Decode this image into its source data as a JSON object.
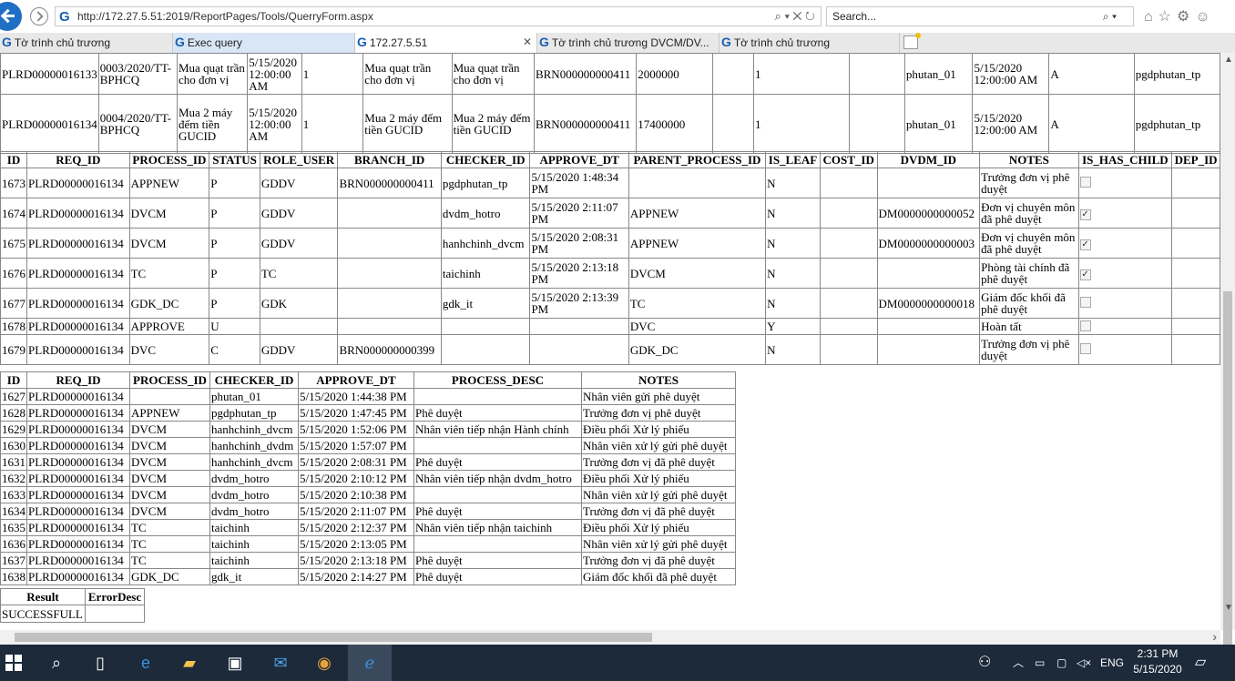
{
  "browser": {
    "url": "http://172.27.5.51:2019/ReportPages/Tools/QuerryForm.aspx",
    "url_icons": "⌕ ▾ ✕ ↻",
    "search_placeholder": "Search...",
    "tabs": [
      {
        "label": "Tờ trình chủ trương"
      },
      {
        "label": "Exec query"
      },
      {
        "label": "172.27.5.51"
      },
      {
        "label": "Tờ trình chủ trương DVCM/DV..."
      },
      {
        "label": "Tờ trình chủ trương"
      }
    ]
  },
  "table1": {
    "rows": [
      [
        "PLRD00000016133",
        "0003/2020/TT-BPHCQ",
        "Mua quạt trần cho đơn vị",
        "5/15/2020 12:00:00 AM",
        "1",
        "Mua quạt trần cho đơn vị",
        "Mua quạt trần cho đơn vị",
        "BRN000000000411",
        "2000000",
        "",
        "1",
        "",
        "phutan_01",
        "5/15/2020 12:00:00 AM",
        "A",
        "pgdphutan_tp"
      ],
      [
        "PLRD00000016134",
        "0004/2020/TT-BPHCQ",
        "Mua 2 máy đếm tiền GUCID",
        "5/15/2020 12:00:00 AM",
        "1",
        "Mua 2 máy đếm tiền GUCID",
        "Mua 2 máy đếm tiền GUCID",
        "BRN000000000411",
        "17400000",
        "",
        "1",
        "",
        "phutan_01",
        "5/15/2020 12:00:00 AM",
        "A",
        "pgdphutan_tp"
      ]
    ]
  },
  "table2": {
    "headers": [
      "ID",
      "REQ_ID",
      "PROCESS_ID",
      "STATUS",
      "ROLE_USER",
      "BRANCH_ID",
      "CHECKER_ID",
      "APPROVE_DT",
      "PARENT_PROCESS_ID",
      "IS_LEAF",
      "COST_ID",
      "DVDM_ID",
      "NOTES",
      "IS_HAS_CHILD",
      "DEP_ID"
    ],
    "rows": [
      [
        "1673",
        "PLRD00000016134",
        "APPNEW",
        "P",
        "GDDV",
        "BRN000000000411",
        "pgdphutan_tp",
        "5/15/2020 1:48:34 PM",
        "",
        "N",
        "",
        "",
        "Trưởng đơn vị phê duyệt",
        "",
        ""
      ],
      [
        "1674",
        "PLRD00000016134",
        "DVCM",
        "P",
        "GDDV",
        "",
        "dvdm_hotro",
        "5/15/2020 2:11:07 PM",
        "APPNEW",
        "N",
        "",
        "DM0000000000052",
        "Đơn vị chuyên môn đã phê duyệt",
        "✓",
        ""
      ],
      [
        "1675",
        "PLRD00000016134",
        "DVCM",
        "P",
        "GDDV",
        "",
        "hanhchinh_dvcm",
        "5/15/2020 2:08:31 PM",
        "APPNEW",
        "N",
        "",
        "DM0000000000003",
        "Đơn vị chuyên môn đã phê duyệt",
        "✓",
        ""
      ],
      [
        "1676",
        "PLRD00000016134",
        "TC",
        "P",
        "TC",
        "",
        "taichinh",
        "5/15/2020 2:13:18 PM",
        "DVCM",
        "N",
        "",
        "",
        "Phòng tài chính đã phê duyệt",
        "✓",
        ""
      ],
      [
        "1677",
        "PLRD00000016134",
        "GDK_DC",
        "P",
        "GDK",
        "",
        "gdk_it",
        "5/15/2020 2:13:39 PM",
        "TC",
        "N",
        "",
        "DM0000000000018",
        "Giám đốc khối đã phê duyệt",
        "",
        ""
      ],
      [
        "1678",
        "PLRD00000016134",
        "APPROVE",
        "U",
        "",
        "",
        "",
        "",
        "DVC",
        "Y",
        "",
        "",
        "Hoàn tất",
        "",
        ""
      ],
      [
        "1679",
        "PLRD00000016134",
        "DVC",
        "C",
        "GDDV",
        "BRN000000000399",
        "",
        "",
        "GDK_DC",
        "N",
        "",
        "",
        "Trưởng đơn vị phê duyệt",
        "",
        ""
      ]
    ]
  },
  "table3": {
    "headers": [
      "ID",
      "REQ_ID",
      "PROCESS_ID",
      "CHECKER_ID",
      "APPROVE_DT",
      "PROCESS_DESC",
      "NOTES"
    ],
    "rows": [
      [
        "1627",
        "PLRD00000016134",
        "",
        "phutan_01",
        "5/15/2020 1:44:38 PM",
        "",
        "Nhân viên gửi phê duyệt"
      ],
      [
        "1628",
        "PLRD00000016134",
        "APPNEW",
        "pgdphutan_tp",
        "5/15/2020 1:47:45 PM",
        "Phê duyệt",
        "Trưởng đơn vị phê duyệt"
      ],
      [
        "1629",
        "PLRD00000016134",
        "DVCM",
        "hanhchinh_dvcm",
        "5/15/2020 1:52:06 PM",
        "Nhân viên tiếp nhận Hành chính",
        "Điều phối Xử lý phiếu"
      ],
      [
        "1630",
        "PLRD00000016134",
        "DVCM",
        "hanhchinh_dvdm",
        "5/15/2020 1:57:07 PM",
        "",
        "Nhân viên xử lý gửi phê duyệt"
      ],
      [
        "1631",
        "PLRD00000016134",
        "DVCM",
        "hanhchinh_dvcm",
        "5/15/2020 2:08:31 PM",
        "Phê duyệt",
        "Trưởng đơn vị đã phê duyệt"
      ],
      [
        "1632",
        "PLRD00000016134",
        "DVCM",
        "dvdm_hotro",
        "5/15/2020 2:10:12 PM",
        "Nhân viên tiếp nhận dvdm_hotro",
        "Điều phối Xử lý phiếu"
      ],
      [
        "1633",
        "PLRD00000016134",
        "DVCM",
        "dvdm_hotro",
        "5/15/2020 2:10:38 PM",
        "",
        "Nhân viên xử lý gửi phê duyệt"
      ],
      [
        "1634",
        "PLRD00000016134",
        "DVCM",
        "dvdm_hotro",
        "5/15/2020 2:11:07 PM",
        "Phê duyệt",
        "Trưởng đơn vị đã phê duyệt"
      ],
      [
        "1635",
        "PLRD00000016134",
        "TC",
        "taichinh",
        "5/15/2020 2:12:37 PM",
        "Nhân viên tiếp nhận taichinh",
        "Điều phối Xử lý phiếu"
      ],
      [
        "1636",
        "PLRD00000016134",
        "TC",
        "taichinh",
        "5/15/2020 2:13:05 PM",
        "",
        "Nhân viên xử lý gửi phê duyệt"
      ],
      [
        "1637",
        "PLRD00000016134",
        "TC",
        "taichinh",
        "5/15/2020 2:13:18 PM",
        "Phê duyệt",
        "Trưởng đơn vị đã phê duyệt"
      ],
      [
        "1638",
        "PLRD00000016134",
        "GDK_DC",
        "gdk_it",
        "5/15/2020 2:14:27 PM",
        "Phê duyệt",
        "Giám đốc khối đã phê duyệt"
      ]
    ]
  },
  "result": {
    "headers": [
      "Result",
      "ErrorDesc"
    ],
    "row": [
      "SUCCESSFULL",
      ""
    ]
  },
  "taskbar": {
    "language": "ENG",
    "time": "2:31 PM",
    "date": "5/15/2020"
  },
  "colors": {
    "accent": "#1f6fc4",
    "taskbar": "#1c2a3a"
  }
}
